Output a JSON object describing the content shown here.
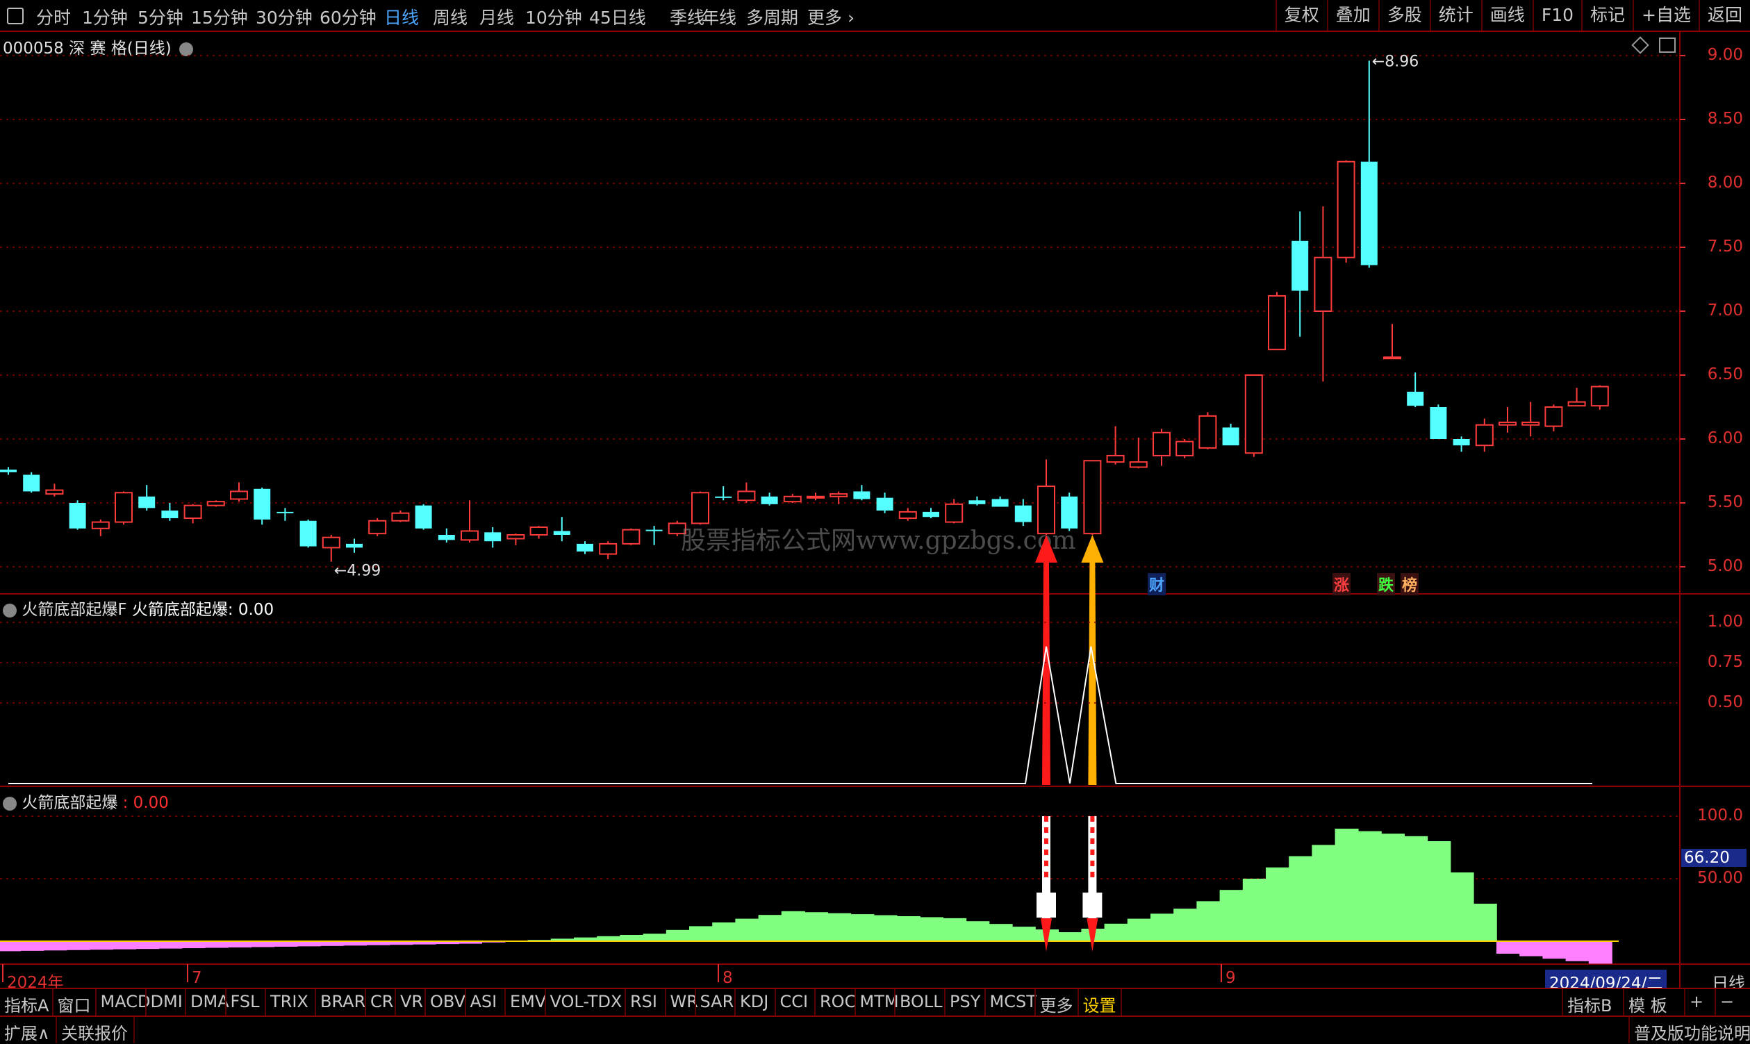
{
  "toolbar": {
    "periods": [
      "分时",
      "1分钟",
      "5分钟",
      "15分钟",
      "30分钟",
      "60分钟",
      "日线",
      "周线",
      "月线",
      "10分钟",
      "45日线",
      "季线",
      "年线",
      "多周期",
      "更多"
    ],
    "active_period": "日线",
    "right_items": [
      "复权",
      "叠加",
      "多股",
      "统计",
      "画线",
      "F10",
      "标记",
      "+自选",
      "返回"
    ]
  },
  "stock": {
    "title": "000058 深 赛 格(日线)"
  },
  "main_chart": {
    "price_axis": [
      "9.00",
      "8.50",
      "8.00",
      "7.50",
      "7.00",
      "6.50",
      "6.00",
      "5.50",
      "5.00"
    ],
    "high_label": "8.96",
    "low_label": "4.99",
    "watermark": "股票指标公式网www.gpzbgs.com",
    "events": [
      {
        "text": "财",
        "color": "#4da6ff"
      },
      {
        "text": "涨",
        "color": "#ff4040"
      },
      {
        "text": "跌",
        "color": "#40ff40"
      },
      {
        "text": "榜",
        "color": "#ffb060"
      }
    ]
  },
  "chart_data": {
    "type": "candlestick",
    "x_axis_labels": [
      "2024年",
      "7",
      "8",
      "9"
    ],
    "ylim": [
      4.9,
      9.1
    ],
    "ohlc": [
      [
        5.76,
        5.78,
        5.72,
        5.74
      ],
      [
        5.72,
        5.74,
        5.58,
        5.59
      ],
      [
        5.57,
        5.65,
        5.55,
        5.6
      ],
      [
        5.5,
        5.52,
        5.29,
        5.3
      ],
      [
        5.3,
        5.37,
        5.24,
        5.35
      ],
      [
        5.35,
        5.59,
        5.33,
        5.58
      ],
      [
        5.55,
        5.64,
        5.44,
        5.46
      ],
      [
        5.44,
        5.5,
        5.36,
        5.38
      ],
      [
        5.38,
        5.49,
        5.34,
        5.48
      ],
      [
        5.48,
        5.52,
        5.47,
        5.51
      ],
      [
        5.53,
        5.66,
        5.51,
        5.59
      ],
      [
        5.61,
        5.62,
        5.33,
        5.37
      ],
      [
        5.43,
        5.46,
        5.36,
        5.42
      ],
      [
        5.36,
        5.37,
        5.15,
        5.16
      ],
      [
        5.15,
        5.25,
        5.04,
        5.23
      ],
      [
        5.18,
        5.22,
        5.11,
        5.15
      ],
      [
        5.26,
        5.38,
        5.24,
        5.36
      ],
      [
        5.36,
        5.44,
        5.35,
        5.42
      ],
      [
        5.48,
        5.49,
        5.29,
        5.3
      ],
      [
        5.25,
        5.3,
        5.19,
        5.21
      ],
      [
        5.21,
        5.52,
        5.19,
        5.28
      ],
      [
        5.27,
        5.31,
        5.15,
        5.2
      ],
      [
        5.22,
        5.26,
        5.17,
        5.25
      ],
      [
        5.25,
        5.32,
        5.22,
        5.31
      ],
      [
        5.28,
        5.39,
        5.2,
        5.25
      ],
      [
        5.18,
        5.2,
        5.1,
        5.12
      ],
      [
        5.1,
        5.2,
        5.06,
        5.18
      ],
      [
        5.18,
        5.3,
        5.17,
        5.29
      ],
      [
        5.29,
        5.32,
        5.17,
        5.28
      ],
      [
        5.26,
        5.36,
        5.24,
        5.34
      ],
      [
        5.34,
        5.59,
        5.33,
        5.58
      ],
      [
        5.55,
        5.63,
        5.52,
        5.54
      ],
      [
        5.52,
        5.66,
        5.5,
        5.59
      ],
      [
        5.55,
        5.58,
        5.48,
        5.49
      ],
      [
        5.51,
        5.57,
        5.5,
        5.55
      ],
      [
        5.55,
        5.58,
        5.52,
        5.55
      ],
      [
        5.55,
        5.59,
        5.49,
        5.57
      ],
      [
        5.59,
        5.64,
        5.52,
        5.53
      ],
      [
        5.54,
        5.58,
        5.42,
        5.44
      ],
      [
        5.38,
        5.46,
        5.36,
        5.43
      ],
      [
        5.43,
        5.46,
        5.38,
        5.39
      ],
      [
        5.35,
        5.53,
        5.34,
        5.49
      ],
      [
        5.52,
        5.55,
        5.48,
        5.49
      ],
      [
        5.53,
        5.55,
        5.49,
        5.47
      ],
      [
        5.48,
        5.53,
        5.32,
        5.35
      ],
      [
        5.26,
        5.84,
        5.25,
        5.63
      ],
      [
        5.55,
        5.58,
        5.28,
        5.3
      ],
      [
        5.26,
        5.83,
        5.25,
        5.83
      ],
      [
        5.82,
        6.1,
        5.8,
        5.87
      ],
      [
        5.78,
        6.01,
        5.77,
        5.82
      ],
      [
        5.87,
        6.08,
        5.79,
        6.05
      ],
      [
        5.87,
        6.0,
        5.85,
        5.98
      ],
      [
        5.93,
        6.21,
        5.92,
        6.18
      ],
      [
        6.09,
        6.12,
        5.98,
        5.95
      ],
      [
        5.89,
        6.32,
        5.86,
        6.5
      ],
      [
        6.7,
        7.15,
        6.7,
        7.12
      ],
      [
        7.55,
        7.78,
        6.8,
        7.16
      ],
      [
        7.0,
        7.82,
        6.45,
        7.42
      ],
      [
        7.42,
        8.18,
        7.38,
        8.17
      ],
      [
        8.17,
        8.96,
        7.34,
        7.36
      ],
      [
        6.64,
        6.9,
        6.64,
        6.64
      ],
      [
        6.37,
        6.52,
        6.25,
        6.26
      ],
      [
        6.25,
        6.27,
        6.0,
        6.0
      ],
      [
        6.0,
        6.02,
        5.9,
        5.95
      ],
      [
        5.95,
        6.16,
        5.9,
        6.11
      ],
      [
        6.11,
        6.25,
        6.05,
        6.13
      ],
      [
        6.11,
        6.29,
        6.02,
        6.13
      ],
      [
        6.1,
        6.27,
        6.06,
        6.25
      ],
      [
        6.26,
        6.4,
        6.26,
        6.29
      ],
      [
        6.26,
        6.42,
        6.23,
        6.41
      ]
    ]
  },
  "indicator1": {
    "title_name": "火箭底部起爆F",
    "title_value_label": "火箭底部起爆: 0.00",
    "axis": [
      "1.00",
      "0.75",
      "0.50"
    ]
  },
  "indicator2": {
    "title_name": "火箭底部起爆",
    "title_value": ": 0.00",
    "axis": [
      "100.0",
      "50.00"
    ],
    "current_value": "66.20"
  },
  "date_axis": {
    "current": "2024/09/24/二",
    "mode": "日线"
  },
  "bottom_tabs": {
    "left_label": "指标A",
    "tabs": [
      "窗口",
      "MACD",
      "DMI",
      "DMA",
      "FSL",
      "TRIX",
      "BRAR",
      "CR",
      "VR",
      "OBV",
      "ASI",
      "EMV",
      "VOL-TDX",
      "RSI",
      "WR",
      "SAR",
      "KDJ",
      "CCI",
      "ROC",
      "MTM",
      "BOLL",
      "PSY",
      "MCST",
      "更多",
      "设置"
    ],
    "right_items": [
      "指标B",
      "模 板",
      "+",
      "−"
    ]
  },
  "status_bar": {
    "expand": "扩展∧",
    "linked_quote": "关联报价",
    "edition_info": "普及版功能说明"
  },
  "colors": {
    "up": "#ff3c3c",
    "down": "#54ffff",
    "grid": "#8b0000",
    "axis_text": "#e03030",
    "green_hist": "#80ff80",
    "pink_hist": "#ff80ff"
  }
}
